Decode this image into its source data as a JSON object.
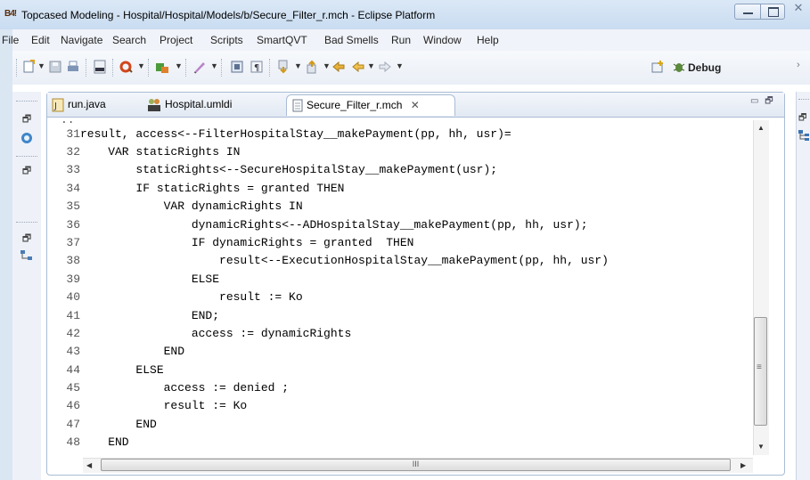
{
  "window": {
    "title": "Topcased Modeling - Hospital/Hospital/Models/b/Secure_Filter_r.mch - Eclipse Platform",
    "logo_text": "B4!"
  },
  "menu": [
    "File",
    "Edit",
    "Navigate",
    "Search",
    "Project",
    "Scripts",
    "SmartQVT",
    "Bad Smells",
    "Run",
    "Window",
    "Help"
  ],
  "toolbar": {
    "debug_label": "Debug"
  },
  "tabs": [
    {
      "label": "run.java",
      "icon": "java-file-icon"
    },
    {
      "label": "Hospital.umldi",
      "icon": "uml-diagram-icon"
    },
    {
      "label": "Secure_Filter_r.mch",
      "icon": "text-file-icon",
      "active": true
    }
  ],
  "editor": {
    "lines": [
      {
        "num": "31",
        "text": "result, access<--FilterHospitalStay__makePayment(pp, hh, usr)="
      },
      {
        "num": "32",
        "text": "    VAR staticRights IN"
      },
      {
        "num": "33",
        "text": "        staticRights<--SecureHospitalStay__makePayment(usr);"
      },
      {
        "num": "34",
        "text": "        IF staticRights = granted THEN"
      },
      {
        "num": "35",
        "text": "            VAR dynamicRights IN"
      },
      {
        "num": "36",
        "text": "                dynamicRights<--ADHospitalStay__makePayment(pp, hh, usr);"
      },
      {
        "num": "37",
        "text": "                IF dynamicRights = granted  THEN"
      },
      {
        "num": "38",
        "text": "                    result<--ExecutionHospitalStay__makePayment(pp, hh, usr)"
      },
      {
        "num": "39",
        "text": "                ELSE"
      },
      {
        "num": "40",
        "text": "                    result := Ko"
      },
      {
        "num": "41",
        "text": "                END;"
      },
      {
        "num": "42",
        "text": "                access := dynamicRights"
      },
      {
        "num": "43",
        "text": "            END"
      },
      {
        "num": "44",
        "text": "        ELSE"
      },
      {
        "num": "45",
        "text": "            access := denied ;"
      },
      {
        "num": "46",
        "text": "            result := Ko"
      },
      {
        "num": "47",
        "text": "        END"
      },
      {
        "num": "48",
        "text": "    END"
      }
    ]
  },
  "scrollbar": {
    "h_thumb_grip": "III",
    "v_thumb_grip": "≡"
  }
}
